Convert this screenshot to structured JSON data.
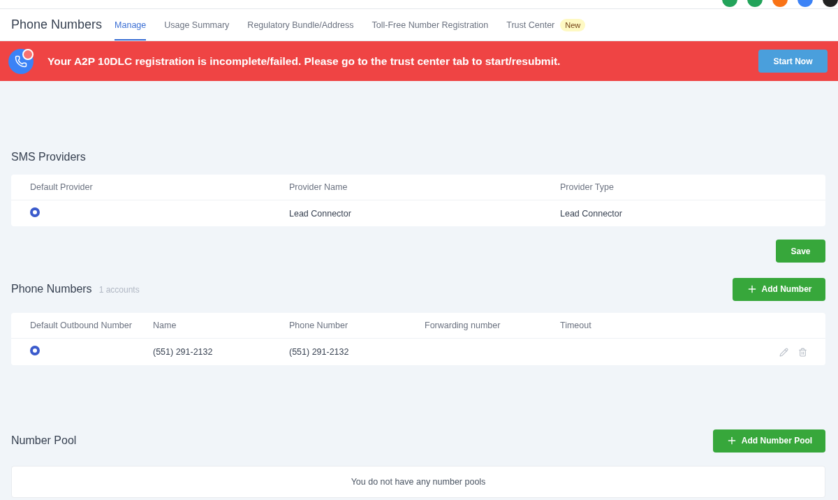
{
  "header": {
    "title": "Phone Numbers",
    "tabs": [
      {
        "label": "Manage",
        "selected": true
      },
      {
        "label": "Usage Summary",
        "selected": false
      },
      {
        "label": "Regulatory Bundle/Address",
        "selected": false
      },
      {
        "label": "Toll-Free Number Registration",
        "selected": false
      },
      {
        "label": "Trust Center",
        "selected": false,
        "badge": "New"
      }
    ]
  },
  "alert": {
    "message": "Your A2P 10DLC registration is incomplete/failed. Please go to the trust center tab to start/resubmit.",
    "button": "Start Now"
  },
  "sms_providers": {
    "title": "SMS Providers",
    "columns": [
      "Default Provider",
      "Provider Name",
      "Provider Type"
    ],
    "rows": [
      {
        "selected": true,
        "name": "Lead Connector",
        "type": "Lead Connector"
      }
    ],
    "save_button": "Save"
  },
  "phone_numbers": {
    "title": "Phone Numbers",
    "count": "1 accounts",
    "add_button": "Add Number",
    "columns": [
      "Default Outbound Number",
      "Name",
      "Phone Number",
      "Forwarding number",
      "Timeout"
    ],
    "rows": [
      {
        "selected": true,
        "name": "(551) 291-2132",
        "number": "(551) 291-2132",
        "forwarding": "",
        "timeout": ""
      }
    ]
  },
  "number_pool": {
    "title": "Number Pool",
    "add_button": "Add Number Pool",
    "empty_text": "You do not have any number pools"
  }
}
